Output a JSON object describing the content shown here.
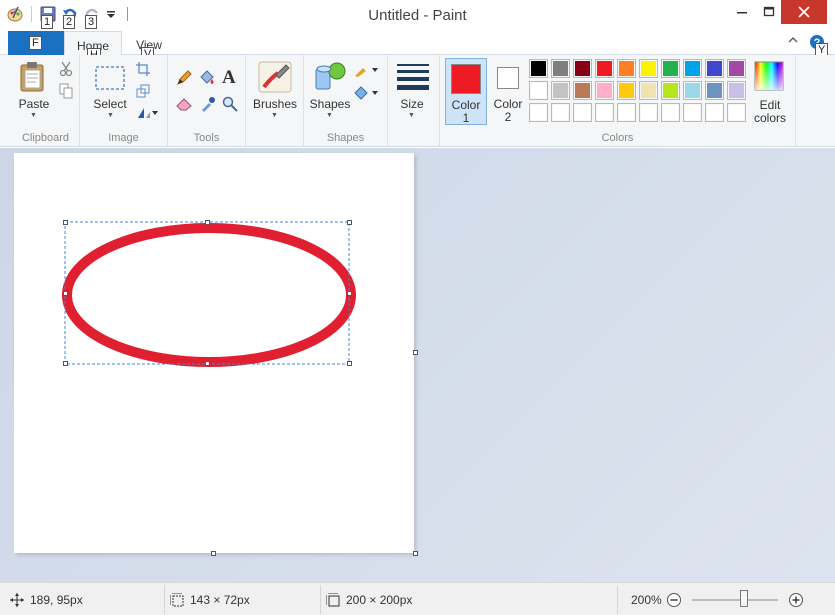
{
  "window": {
    "title": "Untitled - Paint"
  },
  "qat": {
    "keytips": [
      "1",
      "2",
      "3"
    ]
  },
  "tabs": {
    "file_keytip": "F",
    "home": "Home",
    "home_keytip": "H",
    "view": "View",
    "view_keytip": "V",
    "help_keytip": "Y"
  },
  "ribbon": {
    "clipboard": {
      "label": "Clipboard",
      "paste": "Paste"
    },
    "image": {
      "label": "Image",
      "select": "Select"
    },
    "tools": {
      "label": "Tools"
    },
    "brushes": {
      "label": "Brushes"
    },
    "shapes": {
      "label": "Shapes",
      "button": "Shapes"
    },
    "size": {
      "label": "Size"
    },
    "colors": {
      "label": "Colors",
      "color1_label": "Color",
      "color1_num": "1",
      "color2_label": "Color",
      "color2_num": "2",
      "color1_value": "#ed1c24",
      "color2_value": "#ffffff",
      "edit_colors_line1": "Edit",
      "edit_colors_line2": "colors",
      "palette_row1": [
        "#000000",
        "#7f7f7f",
        "#880015",
        "#ed1c24",
        "#ff7f27",
        "#fff200",
        "#22b14c",
        "#00a2e8",
        "#3f48cc",
        "#a349a4"
      ],
      "palette_row2": [
        "#ffffff",
        "#c3c3c3",
        "#b97a57",
        "#ffaec9",
        "#ffc90e",
        "#efe4b0",
        "#b5e61d",
        "#99d9ea",
        "#7092be",
        "#c8bfe7"
      ],
      "palette_row3": [
        "#ffffff",
        "#ffffff",
        "#ffffff",
        "#ffffff",
        "#ffffff",
        "#ffffff",
        "#ffffff",
        "#ffffff",
        "#ffffff",
        "#ffffff"
      ]
    }
  },
  "status": {
    "cursor_pos": "189, 95px",
    "selection_size": "143 × 72px",
    "canvas_size": "200 × 200px",
    "zoom": "200%",
    "zoom_level": 0.6
  }
}
